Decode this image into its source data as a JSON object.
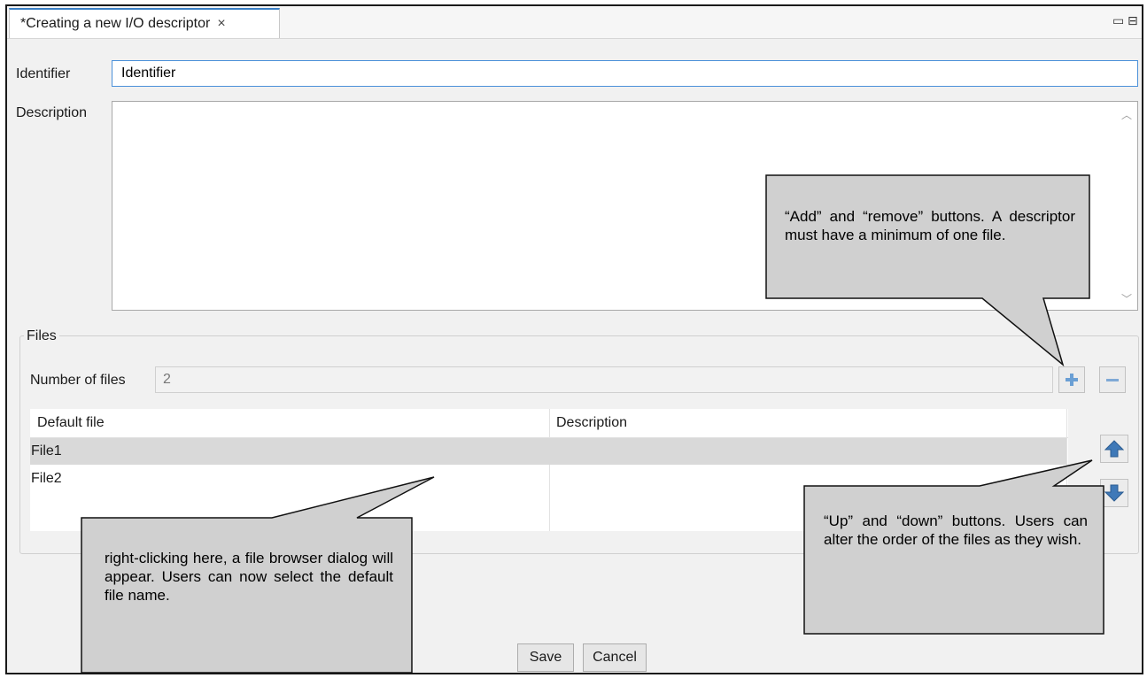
{
  "tab": {
    "title": "*Creating a new I/O descriptor",
    "close_glyph": "×"
  },
  "window_controls": {
    "minimize_glyph": "▭",
    "maximize_glyph": "⊟"
  },
  "form": {
    "identifier_label": "Identifier",
    "identifier_value": "Identifier",
    "description_label": "Description",
    "description_value": ""
  },
  "files": {
    "group_label": "Files",
    "count_label": "Number of files",
    "count_value": "2",
    "columns": [
      "Default file",
      "Description"
    ],
    "rows": [
      {
        "file": "File1",
        "description": "",
        "selected": true
      },
      {
        "file": "File2",
        "description": "",
        "selected": false
      }
    ]
  },
  "buttons": {
    "save": "Save",
    "cancel": "Cancel"
  },
  "callouts": {
    "add_remove": "“Add” and “remove” buttons. A descriptor must have a minimum of one file.",
    "up_down": "“Up” and “down” buttons. Users can alter the order of the files as they wish.",
    "right_click": "right-clicking here, a file browser dialog will appear. Users can now select the default file name."
  },
  "icons": {
    "add": "plus-icon",
    "remove": "minus-icon",
    "up": "arrow-up-icon",
    "down": "arrow-down-icon",
    "accent_color": "#3a7fc4"
  }
}
